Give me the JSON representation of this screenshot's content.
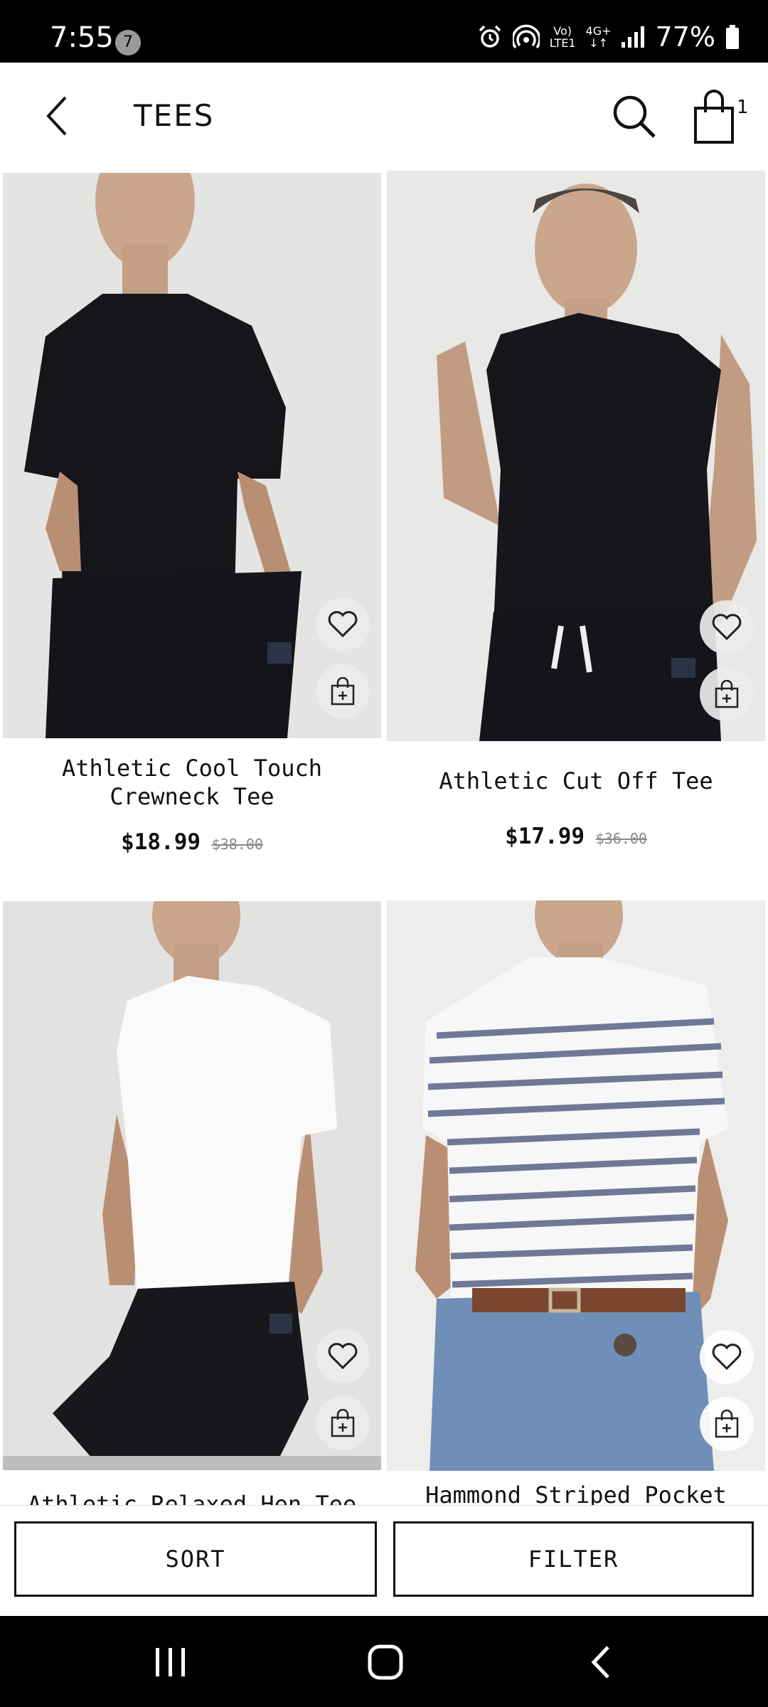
{
  "status_bar": {
    "time": "7:55",
    "notification_count": "7",
    "network_label_top": "Vo)",
    "network_label_bottom": "LTE1",
    "data_label": "4G+",
    "battery": "77%"
  },
  "header": {
    "title": "TEES",
    "cart_count": "1"
  },
  "products": [
    {
      "name": "Athletic Cool Touch Crewneck Tee",
      "price": "$18.99",
      "old_price": "$38.00",
      "shirt_color": "#15151a",
      "pants_color": "#14141a"
    },
    {
      "name": "Athletic Cut Off Tee",
      "price": "$17.99",
      "old_price": "$36.00",
      "shirt_color": "#16161b",
      "pants_color": "#14141a"
    },
    {
      "name": "Athletic Relaxed Hen Tee",
      "shirt_color": "#fafafa",
      "pants_color": "#17171c"
    },
    {
      "name": "Hammond Striped Pocket",
      "shirt_color": "#f7f7f7",
      "pants_color": "#6f8fb8"
    }
  ],
  "actions": {
    "sort_label": "SORT",
    "filter_label": "FILTER"
  },
  "colors": {
    "status_bar_bg": "#000000",
    "text_primary": "#111111",
    "old_price": "#888888",
    "photo_bg": "#e5e5e3"
  }
}
